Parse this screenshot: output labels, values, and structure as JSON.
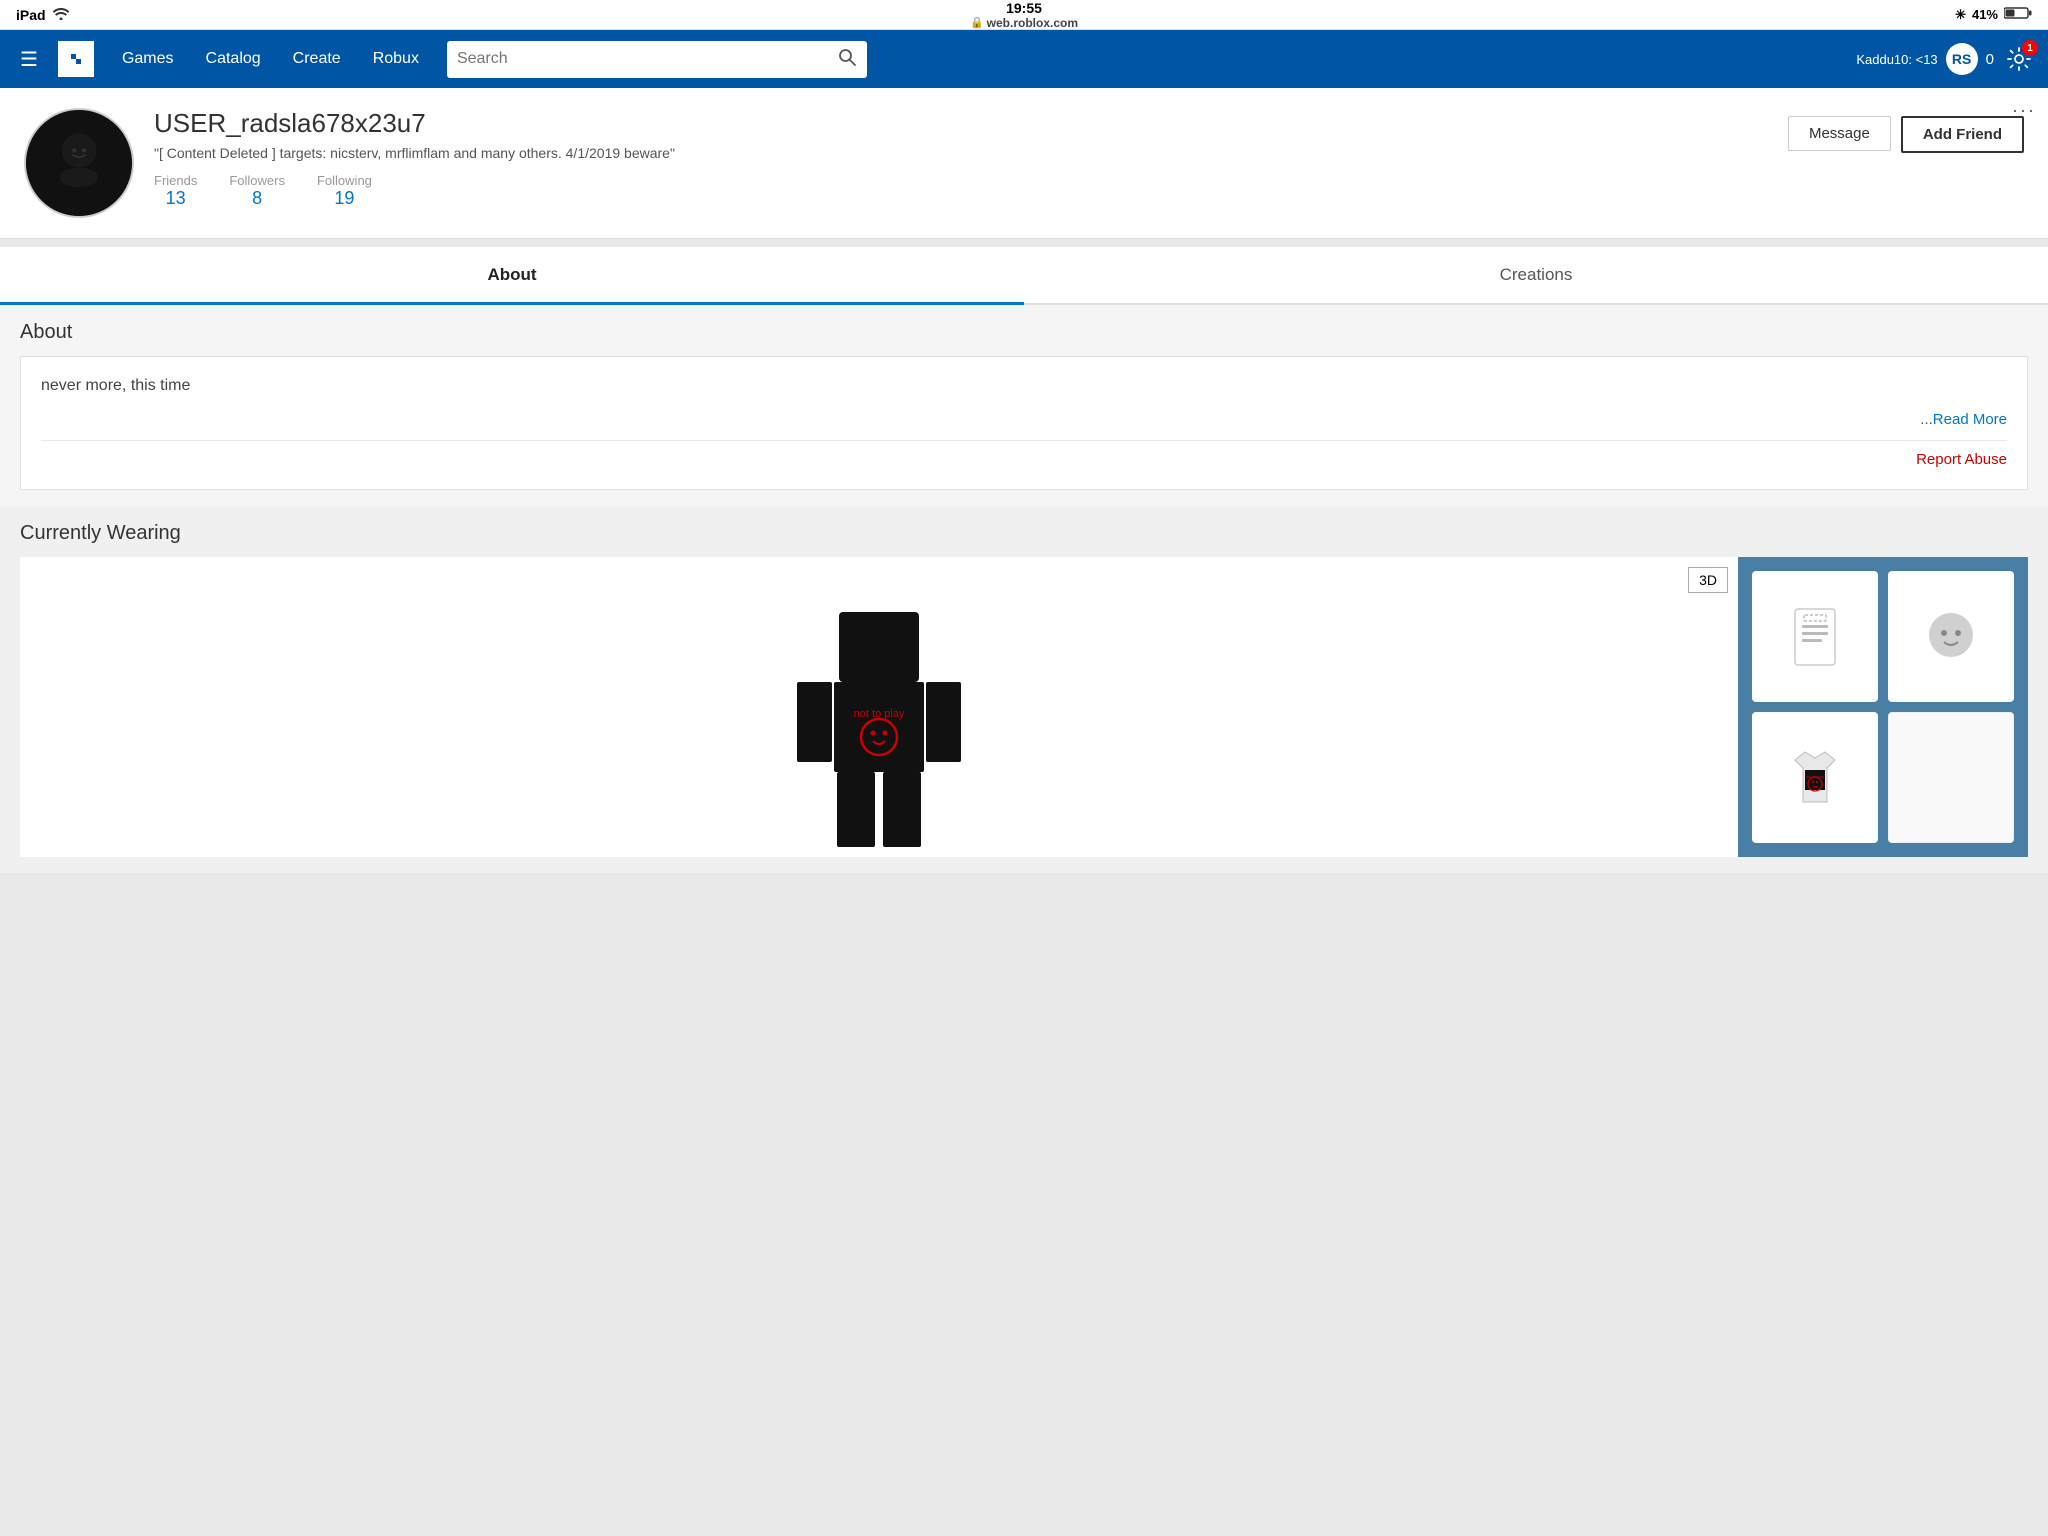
{
  "statusBar": {
    "left": "iPad",
    "wifi": "wifi",
    "time": "19:55",
    "lock": "🔒",
    "url": "web.roblox.com",
    "bluetooth": "bluetooth",
    "battery": "41%"
  },
  "navbar": {
    "hamburger": "☰",
    "logo": "◆",
    "links": [
      {
        "label": "Games",
        "id": "games"
      },
      {
        "label": "Catalog",
        "id": "catalog"
      },
      {
        "label": "Create",
        "id": "create"
      },
      {
        "label": "Robux",
        "id": "robux"
      }
    ],
    "search_placeholder": "Search",
    "search_icon": "🔍",
    "user_label": "Kaddu10: <13",
    "robux_icon": "RS",
    "robux_count": "0",
    "settings_badge": "1"
  },
  "profile": {
    "username": "USER_radsla678x23u7",
    "bio": "\"[ Content Deleted ] targets: nicsterv, mrflimflam and many others. 4/1/2019 beware\"",
    "stats": {
      "friends_label": "Friends",
      "friends_value": "13",
      "followers_label": "Followers",
      "followers_value": "8",
      "following_label": "Following",
      "following_value": "19"
    },
    "btn_message": "Message",
    "btn_add_friend": "Add Friend",
    "more_dots": "···"
  },
  "tabs": [
    {
      "label": "About",
      "active": true
    },
    {
      "label": "Creations",
      "active": false
    }
  ],
  "about": {
    "heading": "About",
    "text": "never more, this time",
    "read_more_prefix": "...",
    "read_more_label": "Read More",
    "report_abuse_label": "Report Abuse"
  },
  "wearing": {
    "heading": "Currently Wearing",
    "btn_3d": "3D",
    "items": [
      {
        "icon": "📄",
        "type": "placeholder"
      },
      {
        "icon": "😐",
        "type": "head"
      },
      {
        "icon": "👕",
        "type": "shirt"
      },
      {
        "icon": "",
        "type": "empty"
      }
    ]
  }
}
